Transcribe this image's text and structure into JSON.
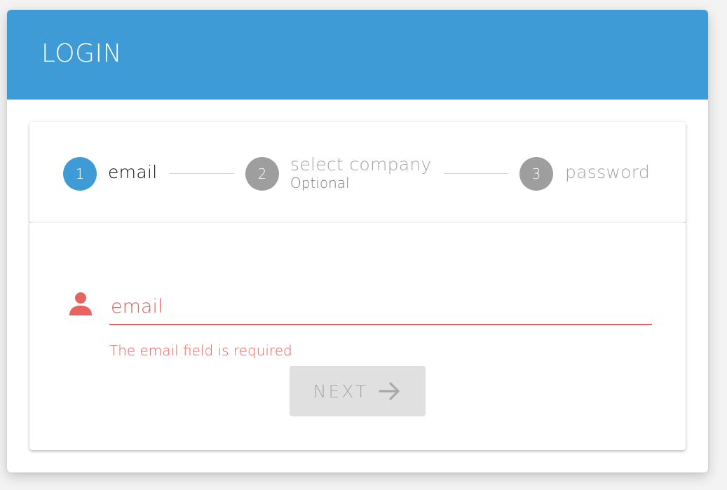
{
  "header": {
    "title": "LOGIN"
  },
  "stepper": {
    "steps": [
      {
        "number": "1",
        "label": "email",
        "state": "active"
      },
      {
        "number": "2",
        "label": "select company",
        "sublabel": "Optional",
        "state": "inactive"
      },
      {
        "number": "3",
        "label": "password",
        "state": "inactive"
      }
    ]
  },
  "form": {
    "email": {
      "placeholder": "email",
      "value": "",
      "error": "The email field is required"
    },
    "next_button": {
      "label": "NEXT",
      "icon": "arrow-right-icon",
      "disabled": true
    }
  },
  "colors": {
    "primary": "#3f9bd6",
    "error": "#e8625f",
    "inactive_step": "#9e9e9e",
    "disabled_button_bg": "#e0e0e0"
  }
}
